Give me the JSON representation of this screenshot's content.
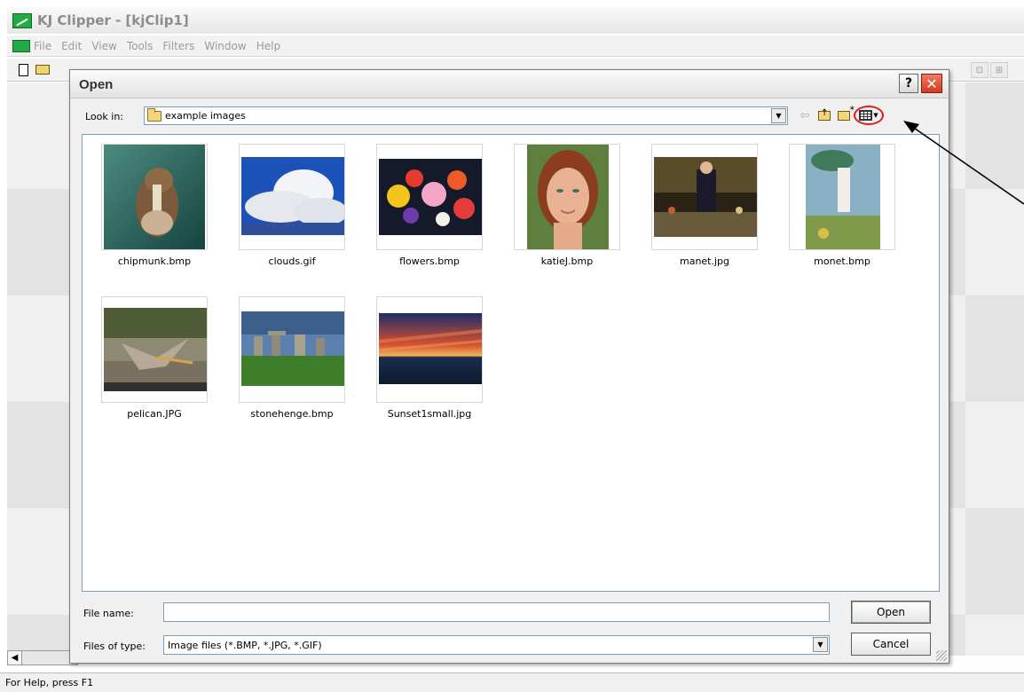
{
  "app": {
    "title": "KJ Clipper - [kjClip1]",
    "menu": [
      "File",
      "Edit",
      "View",
      "Tools",
      "Filters",
      "Window",
      "Help"
    ],
    "status": "For Help, press F1"
  },
  "dialog": {
    "title": "Open",
    "help_label": "?",
    "close_label": "✕",
    "look_in_label": "Look in:",
    "look_in_value": "example images",
    "files": [
      {
        "name": "chipmunk.bmp"
      },
      {
        "name": "clouds.gif"
      },
      {
        "name": "flowers.bmp"
      },
      {
        "name": "katieJ.bmp"
      },
      {
        "name": "manet.jpg"
      },
      {
        "name": "monet.bmp"
      },
      {
        "name": "pelican.JPG"
      },
      {
        "name": "stonehenge.bmp"
      },
      {
        "name": "Sunset1small.jpg"
      }
    ],
    "file_name_label": "File name:",
    "file_name_value": "",
    "files_of_type_label": "Files of type:",
    "files_of_type_value": "Image files (*.BMP, *.JPG, *.GIF)",
    "open_label": "Open",
    "cancel_label": "Cancel"
  },
  "icons": {
    "back": "back-arrow-icon",
    "up": "up-folder-icon",
    "new_folder": "new-folder-icon",
    "views": "views-menu-icon"
  },
  "colors": {
    "highlight_circle": "#e01a1a",
    "app_icon": "#22aa44",
    "close_button": "#d23b1d"
  }
}
